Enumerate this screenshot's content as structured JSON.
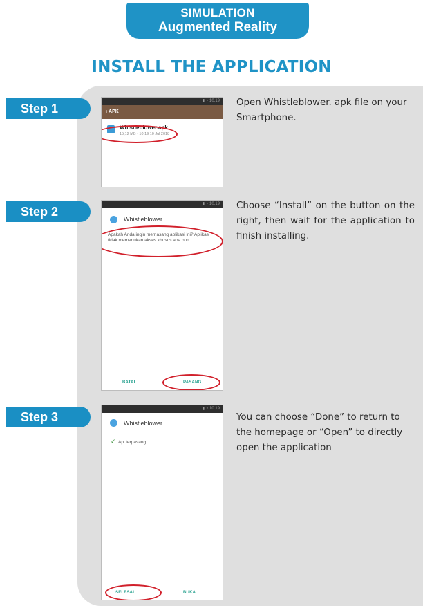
{
  "banner": {
    "line1": "SIMULATION",
    "line2": "Augmented Reality"
  },
  "page_title": "INSTALL THE APPLICATION",
  "steps": [
    {
      "label": "Step 1",
      "description": "Open Whistleblower. apk file on your Smartphone.",
      "phone": {
        "toolbar_label": "APK",
        "file_name": "Whistleblower.apk",
        "file_meta": "15,12 MB  ·  10.19 10 Jul 2018"
      }
    },
    {
      "label": "Step 2",
      "description": "Choose “Install” on the button on the right, then wait for the application to finish installing.",
      "phone": {
        "app_name": "Whistleblower",
        "dialog_text": "Apakah Anda ingin memasang aplikasi ini? Aplikasi tidak memerlukan akses khusus apa pun.",
        "cancel_label": "BATAL",
        "install_label": "PASANG"
      }
    },
    {
      "label": "Step 3",
      "description": "You can choose “Done” to return to the homepage or “Open” to directly open the application",
      "phone": {
        "app_name": "Whistleblower",
        "installed_text": "Apl terpasang.",
        "done_label": "SELESAI",
        "open_label": "BUKA"
      }
    }
  ],
  "colors": {
    "accent": "#1f93c6",
    "highlight": "#d1202b",
    "panel": "#dfdfdf"
  }
}
